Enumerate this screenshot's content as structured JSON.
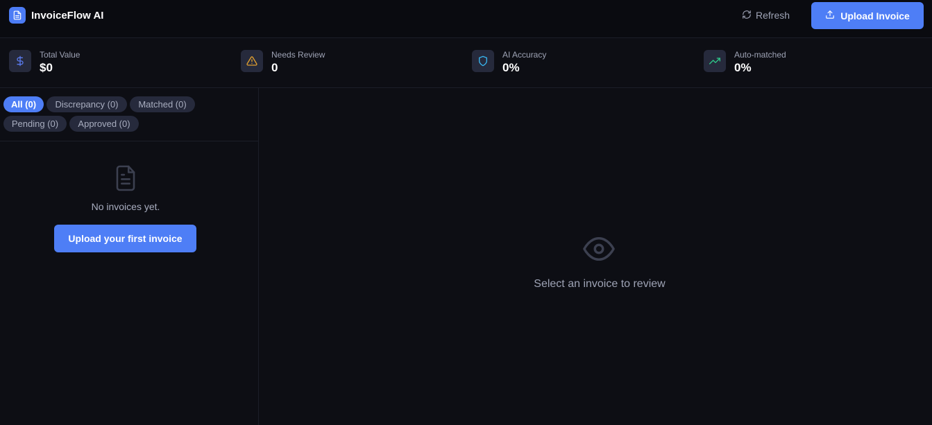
{
  "app": {
    "title": "InvoiceFlow AI",
    "logo_icon": "file-text-icon"
  },
  "header": {
    "refresh_label": "Refresh",
    "upload_label": "Upload Invoice"
  },
  "stats": [
    {
      "label": "Total Value",
      "value": "$0",
      "icon": "dollar-icon",
      "color": "#5b7cf0"
    },
    {
      "label": "Needs Review",
      "value": "0",
      "icon": "warning-icon",
      "color": "#e3a12f"
    },
    {
      "label": "AI Accuracy",
      "value": "0%",
      "icon": "shield-icon",
      "color": "#38b6f0"
    },
    {
      "label": "Auto-matched",
      "value": "0%",
      "icon": "trending-up-icon",
      "color": "#2fc98a"
    }
  ],
  "filters": [
    {
      "label": "All (0)",
      "active": true
    },
    {
      "label": "Discrepancy (0)",
      "active": false
    },
    {
      "label": "Matched (0)",
      "active": false
    },
    {
      "label": "Pending (0)",
      "active": false
    },
    {
      "label": "Approved (0)",
      "active": false
    }
  ],
  "sidebar": {
    "empty_text": "No invoices yet.",
    "first_upload_label": "Upload your first invoice"
  },
  "main": {
    "empty_text": "Select an invoice to review"
  },
  "colors": {
    "accent": "#4e7ef6",
    "background": "#0d0e14",
    "header_background": "#0a0b10"
  }
}
